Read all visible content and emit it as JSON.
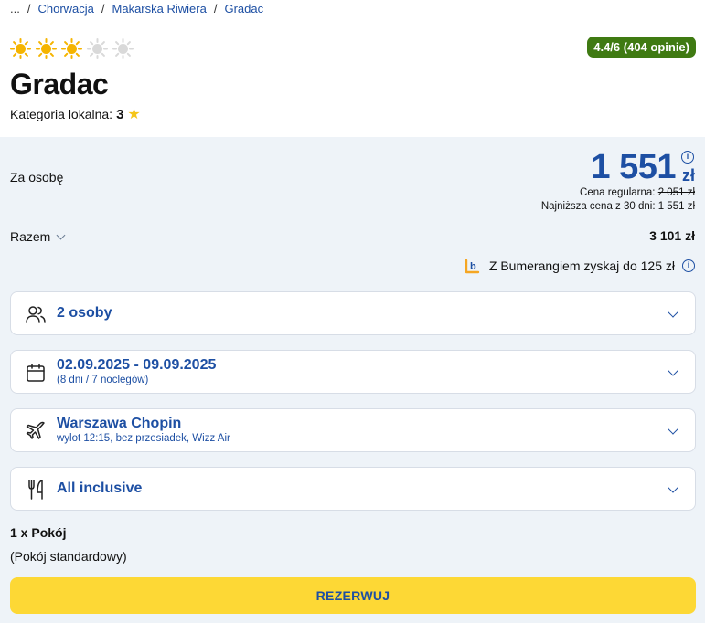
{
  "breadcrumb": {
    "ellipsis": "...",
    "sep": "/",
    "items": [
      "Chorwacja",
      "Makarska Riwiera",
      "Gradac"
    ]
  },
  "hotel": {
    "sun_rating": 3,
    "sun_max": 5,
    "review_badge": "4.4/6 (404 opinie)",
    "name": "Gradac",
    "category_label": "Kategoria lokalna:",
    "category_value": "3"
  },
  "pricing": {
    "per_person_label": "Za osobę",
    "price": "1 551",
    "currency": "zł",
    "regular_label": "Cena regularna:",
    "regular_value": "2 051 zł",
    "lowest_30_label": "Najniższa cena z 30 dni:",
    "lowest_30_value": "1 551 zł",
    "total_label": "Razem",
    "total_value": "3 101 zł",
    "bumerang_text": "Z Bumerangiem zyskaj do 125 zł"
  },
  "options": {
    "persons": {
      "label": "2 osoby"
    },
    "dates": {
      "label": "02.09.2025 - 09.09.2025",
      "sub": "(8 dni / 7 noclegów)"
    },
    "flight": {
      "label": "Warszawa Chopin",
      "sub": "wylot 12:15, bez przesiadek, Wizz Air"
    },
    "board": {
      "label": "All inclusive"
    }
  },
  "room": {
    "count_label": "1 x Pokój",
    "type_label": "(Pokój standardowy)"
  },
  "reserve_button": "REZERWUJ",
  "colors": {
    "accent": "#1d4fa3",
    "badge_green": "#3f7a12",
    "cta_yellow": "#fdd835",
    "panel_bg": "#eef3f8"
  }
}
